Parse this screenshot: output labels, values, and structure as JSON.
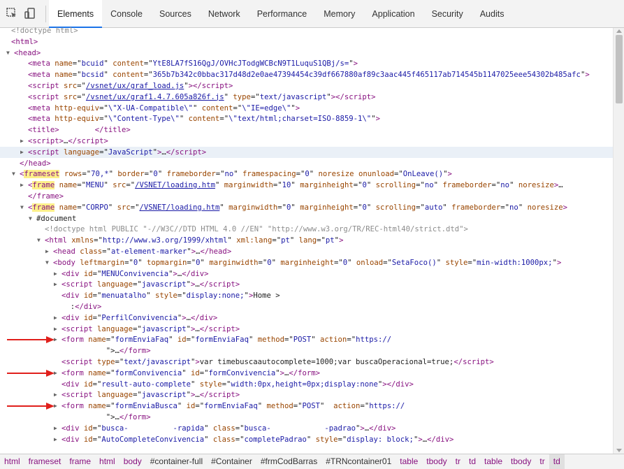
{
  "toolbar": {
    "tabs": [
      {
        "label": "Elements",
        "active": true
      },
      {
        "label": "Console"
      },
      {
        "label": "Sources"
      },
      {
        "label": "Network"
      },
      {
        "label": "Performance"
      },
      {
        "label": "Memory"
      },
      {
        "label": "Application"
      },
      {
        "label": "Security"
      },
      {
        "label": "Audits"
      }
    ],
    "icons": [
      "inspect-element-icon",
      "device-toolbar-icon"
    ]
  },
  "tree": [
    {
      "html": "<span class='doctype'>&lt;!doctype html&gt;</span>"
    },
    {
      "html": "<span class='tag'>&lt;html&gt;</span>"
    },
    {
      "tri": "down",
      "html": "<span class='tag'>&lt;head&gt;</span>"
    },
    {
      "html": "<span class='tag'>&lt;meta </span><span class='attr'>name</span>=\"<span class='val'>bcuid</span>\" <span class='attr'>content</span>=\"<span class='val'>YtE8LA7fS16QgJ/OVHcJTodgWCBcN9T1LuquS1QBj/s=</span>\"<span class='tag'>&gt;</span>"
    },
    {
      "html": "<span class='tag'>&lt;meta </span><span class='attr'>name</span>=\"<span class='val'>bcsid</span>\" <span class='attr'>content</span>=\"<span class='val'>365b7b342c0bbac317d48d2e0ae47394454c39df667880af89c3aac445f465117ab714545b1147025eee54302b485afc</span>\"<span class='tag'>&gt;</span>"
    },
    {
      "html": "<span class='tag'>&lt;script </span><span class='attr'>src</span>=\"<span class='link'>/vsnet/ux/graf_load.js</span>\"<span class='tag'>&gt;&lt;/script&gt;</span>"
    },
    {
      "html": "<span class='tag'>&lt;script </span><span class='attr'>src</span>=\"<span class='link'>/vsnet/ux/graf1.4.7.605a826f.js</span>\" <span class='attr'>type</span>=\"<span class='val'>text/javascript</span>\"<span class='tag'>&gt;&lt;/script&gt;</span>"
    },
    {
      "html": "<span class='tag'>&lt;meta </span><span class='attr'>http-equiv</span>=\"<span class='val'>\\\"X-UA-Compatible\\\"</span>\" <span class='attr'>content</span>=\"<span class='val'>\\\"IE=edge\\\"</span>\"<span class='tag'>&gt;</span>"
    },
    {
      "html": "<span class='tag'>&lt;meta </span><span class='attr'>http-equiv</span>=\"<span class='val'>\\\"Content-Type\\\"</span>\" <span class='attr'>content</span>=\"<span class='val'>\\\"text/html;charset=ISO-8859-1\\\"</span>\"<span class='tag'>&gt;</span>"
    },
    {
      "html": "<span class='tag'>&lt;title&gt;</span>        <span class='tag'>&lt;/title&gt;</span>"
    },
    {
      "tri": "right",
      "html": "<span class='tag'>&lt;script&gt;</span>…<span class='tag'>&lt;/script&gt;</span>"
    },
    {
      "tri": "right",
      "hl": true,
      "html": "<span class='tag'>&lt;script </span><span class='attr'>language</span>=\"<span class='val'>JavaScript</span>\"<span class='tag'>&gt;</span>…<span class='tag'>&lt;/script&gt;</span>"
    },
    {
      "html": "<span class='tag'>&lt;/head&gt;</span>"
    },
    {
      "tri": "down",
      "html": "<span class='tag'>&lt;<span class='mark'>frameset</span> </span><span class='attr'>rows</span>=\"<span class='val'>70,*</span>\" <span class='attr'>border</span>=\"<span class='val'>0</span>\" <span class='attr'>frameborder</span>=\"<span class='val'>no</span>\" <span class='attr'>framespacing</span>=\"<span class='val'>0</span>\" <span class='attr'>noresize</span> <span class='attr'>onunload</span>=\"<span class='val'>OnLeave()</span>\"<span class='tag'>&gt;</span>"
    },
    {
      "tri": "right",
      "html": "<span class='tag'>&lt;<span class='mark'>frame</span> </span><span class='attr'>name</span>=\"<span class='val'>MENU</span>\" <span class='attr'>src</span>=\"<span class='link'>/VSNET/loading.htm</span>\" <span class='attr'>marginwidth</span>=\"<span class='val'>10</span>\" <span class='attr'>marginheight</span>=\"<span class='val'>0</span>\" <span class='attr'>scrolling</span>=\"<span class='val'>no</span>\" <span class='attr'>frameborder</span>=\"<span class='val'>no</span>\" <span class='attr'>noresize</span><span class='tag'>&gt;</span>…"
    },
    {
      "html": "<span class='tag'>&lt;/frame&gt;</span>"
    },
    {
      "tri": "down",
      "html": "<span class='tag'>&lt;<span class='mark'>frame</span> </span><span class='attr'>name</span>=\"<span class='val'>CORPO</span>\" <span class='attr'>src</span>=\"<span class='link'>/VSNET/loading.htm</span>\" <span class='attr'>marginwidth</span>=\"<span class='val'>0</span>\" <span class='attr'>marginheight</span>=\"<span class='val'>0</span>\" <span class='attr'>scrolling</span>=\"<span class='val'>auto</span>\" <span class='attr'>frameborder</span>=\"<span class='val'>no</span>\" <span class='attr'>noresize</span><span class='tag'>&gt;</span>"
    },
    {
      "tri": "down",
      "html": "<span class='txt'>#document</span>"
    },
    {
      "html": "<span class='doctype'>&lt;!doctype html PUBLIC \"-//W3C//DTD HTML 4.0 //EN\" \"http://www.w3.org/TR/REC-html40/strict.dtd\"&gt;</span>"
    },
    {
      "tri": "down",
      "html": "<span class='tag'>&lt;html </span><span class='attr'>xmlns</span>=\"<span class='val'>http://www.w3.org/1999/xhtml</span>\" <span class='attr'>xml:lang</span>=\"<span class='val'>pt</span>\" <span class='attr'>lang</span>=\"<span class='val'>pt</span>\"<span class='tag'>&gt;</span>"
    },
    {
      "tri": "right",
      "html": "<span class='tag'>&lt;head </span><span class='attr'>class</span>=\"<span class='val'>at-element-marker</span>\"<span class='tag'>&gt;</span>…<span class='tag'>&lt;/head&gt;</span>"
    },
    {
      "tri": "down",
      "html": "<span class='tag'>&lt;body </span><span class='attr'>leftmargin</span>=\"<span class='val'>0</span>\" <span class='attr'>topmargin</span>=\"<span class='val'>0</span>\" <span class='attr'>marginwidth</span>=\"<span class='val'>0</span>\" <span class='attr'>marginheight</span>=\"<span class='val'>0</span>\" <span class='attr'>onload</span>=\"<span class='val'>SetaFoco()</span>\" <span class='attr'>style</span>=\"<span class='val'>min-width:1000px;</span>\"<span class='tag'>&gt;</span>"
    },
    {
      "tri": "right",
      "html": "<span class='tag'>&lt;div </span><span class='attr'>id</span>=\"<span class='val'>MENUConvivencia</span>\"<span class='tag'>&gt;</span>…<span class='tag'>&lt;/div&gt;</span>"
    },
    {
      "tri": "right",
      "html": "<span class='tag'>&lt;script </span><span class='attr'>language</span>=\"<span class='val'>javascript</span>\"<span class='tag'>&gt;</span>…<span class='tag'>&lt;/script&gt;</span>"
    },
    {
      "html": "<span class='tag'>&lt;div </span><span class='attr'>id</span>=\"<span class='val'>menuatalho</span>\" <span class='attr'>style</span>=\"<span class='val'>display:none;</span>\"<span class='tag'>&gt;</span><span class='txt'>Home &gt;</span>"
    },
    {
      "html": "  <span class='txt'>:</span><span class='tag'>&lt;/div&gt;</span>"
    },
    {
      "tri": "right",
      "html": "<span class='tag'>&lt;div </span><span class='attr'>id</span>=\"<span class='val'>PerfilConvivencia</span>\"<span class='tag'>&gt;</span>…<span class='tag'>&lt;/div&gt;</span>"
    },
    {
      "tri": "right",
      "html": "<span class='tag'>&lt;script </span><span class='attr'>language</span>=\"<span class='val'>javascript</span>\"<span class='tag'>&gt;</span>…<span class='tag'>&lt;/script&gt;</span>"
    },
    {
      "tri": "right",
      "arrow": true,
      "html": "<span class='tag'>&lt;form </span><span class='attr'>name</span>=\"<span class='val'>formEnviaFaq</span>\" <span class='attr'>id</span>=\"<span class='val'>formEnviaFaq</span>\" <span class='attr'>method</span>=\"<span class='val'>POST</span>\" <span class='attr'>action</span>=\"<span class='val'>https://</span>"
    },
    {
      "html": "          \"&gt;…<span class='tag'>&lt;/form&gt;</span>"
    },
    {
      "html": "<span class='tag'>&lt;script </span><span class='attr'>type</span>=\"<span class='val'>text/javascript</span>\"<span class='tag'>&gt;</span><span class='txt'>var timebuscaautocomplete=1000;var buscaOperacional=true;</span><span class='tag'>&lt;/script&gt;</span>"
    },
    {
      "tri": "right",
      "arrow": true,
      "html": "<span class='tag'>&lt;form </span><span class='attr'>name</span>=\"<span class='val'>formConvivencia</span>\" <span class='attr'>id</span>=\"<span class='val'>formConvivencia</span>\"<span class='tag'>&gt;</span>…<span class='tag'>&lt;/form&gt;</span>"
    },
    {
      "html": "<span class='tag'>&lt;div </span><span class='attr'>id</span>=\"<span class='val'>result-auto-complete</span>\" <span class='attr'>style</span>=\"<span class='val'>width:0px,height=0px;display:none</span>\"<span class='tag'>&gt;&lt;/div&gt;</span>"
    },
    {
      "tri": "right",
      "html": "<span class='tag'>&lt;script </span><span class='attr'>language</span>=\"<span class='val'>javascript</span>\"<span class='tag'>&gt;</span>…<span class='tag'>&lt;/script&gt;</span>"
    },
    {
      "tri": "right",
      "arrow": true,
      "html": "<span class='tag'>&lt;form </span><span class='attr'>name</span>=\"<span class='val'>formEnviaBusca</span>\" <span class='attr'>id</span>=\"<span class='val'>formEnviaFaq</span>\" <span class='attr'>method</span>=\"<span class='val'>POST</span>\"  <span class='attr'>action</span>=\"<span class='val'>https://</span>"
    },
    {
      "html": "          \"&gt;…<span class='tag'>&lt;/form&gt;</span>"
    },
    {
      "tri": "right",
      "html": "<span class='tag'>&lt;div </span><span class='attr'>id</span>=\"<span class='val'>busca-          -rapida</span>\" <span class='attr'>class</span>=\"<span class='val'>busca-            -padrao</span>\"<span class='tag'>&gt;</span>…<span class='tag'>&lt;/div&gt;</span>"
    },
    {
      "tri": "right",
      "html": "<span class='tag'>&lt;div </span><span class='attr'>id</span>=\"<span class='val'>AutoCompleteConvivencia</span>\" <span class='attr'>class</span>=\"<span class='val'>completePadrao</span>\" <span class='attr'>style</span>=\"<span class='val'>display: block;</span>\"<span class='tag'>&gt;</span>…<span class='tag'>&lt;/div&gt;</span>"
    }
  ],
  "breadcrumbs": [
    {
      "tag": "html"
    },
    {
      "tag": "frameset"
    },
    {
      "tag": "frame"
    },
    {
      "tag": "html"
    },
    {
      "tag": "body"
    },
    {
      "tag": "#container-full"
    },
    {
      "tag": "#Container"
    },
    {
      "tag": "#frmCodBarras"
    },
    {
      "tag": "#TRNcontainer01"
    },
    {
      "tag": "table"
    },
    {
      "tag": "tbody"
    },
    {
      "tag": "tr"
    },
    {
      "tag": "td"
    },
    {
      "tag": "table"
    },
    {
      "tag": "tbody"
    },
    {
      "tag": "tr"
    },
    {
      "tag": "td"
    }
  ],
  "colors": {
    "accent": "#1a73e8",
    "tag": "#881280",
    "attr": "#994500",
    "value": "#1a1aa6",
    "arrow": "#e0201c"
  }
}
